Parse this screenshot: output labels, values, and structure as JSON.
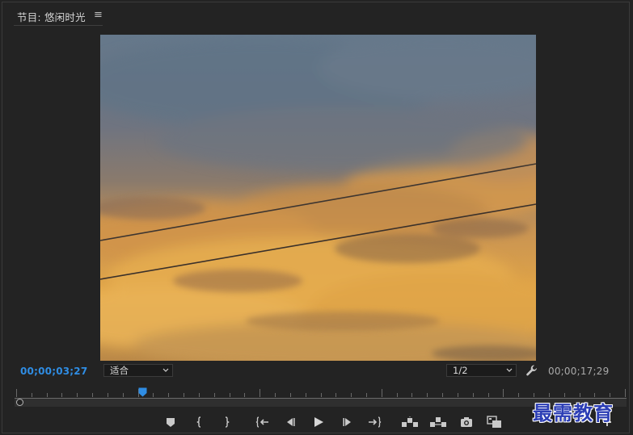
{
  "panel": {
    "title": "节目: 悠闲时光",
    "menu_icon": "hamburger-menu-icon"
  },
  "monitor": {
    "content": "sunset-clouds-video-frame",
    "colors": {
      "sky_top": "#66788b",
      "cloud_gold": "#e3a646",
      "cloud_dark": "#7a5a3a"
    }
  },
  "timecode": {
    "current": "00;00;03;27",
    "duration": "00;00;17;29",
    "current_color": "#2f8de4"
  },
  "zoom": {
    "selected": "适合"
  },
  "resolution": {
    "selected": "1/2"
  },
  "settings_icon": "wrench-icon",
  "playhead_position": 0.21,
  "transport": [
    {
      "name": "add-marker-icon"
    },
    {
      "name": "mark-in-icon"
    },
    {
      "name": "mark-out-icon"
    },
    {
      "name": "go-to-in-icon"
    },
    {
      "name": "step-back-icon"
    },
    {
      "name": "play-icon"
    },
    {
      "name": "step-forward-icon"
    },
    {
      "name": "go-to-out-icon"
    },
    {
      "name": "lift-icon"
    },
    {
      "name": "extract-icon"
    },
    {
      "name": "export-frame-icon"
    },
    {
      "name": "comparison-view-icon"
    }
  ],
  "watermark": "最需教育"
}
